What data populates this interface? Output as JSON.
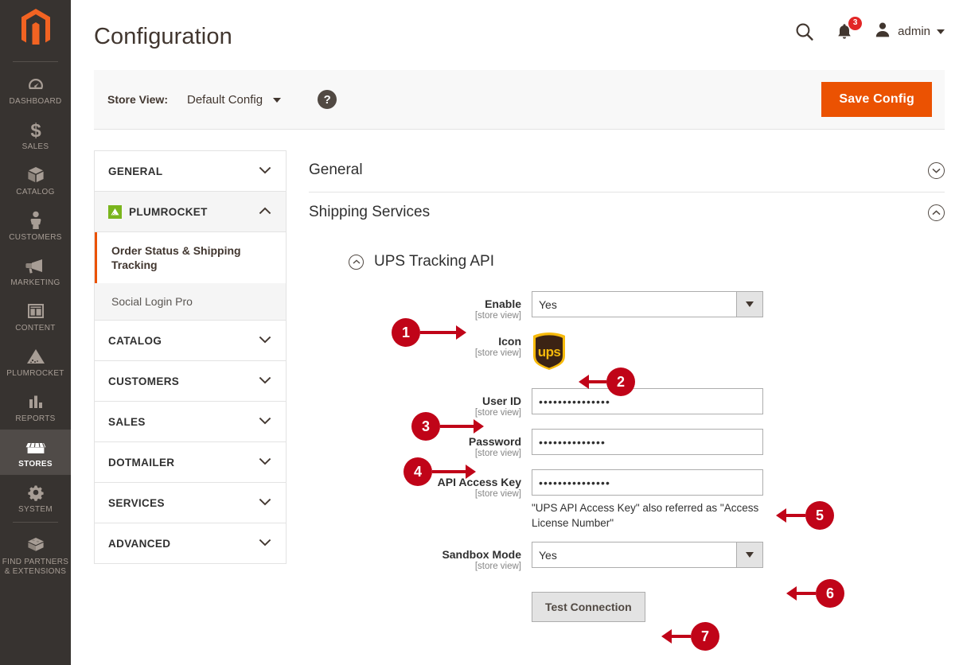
{
  "rail": {
    "logo_icon": "magento-logo-icon",
    "items": [
      {
        "label": "DASHBOARD",
        "icon": "dashboard-icon",
        "active": false
      },
      {
        "label": "SALES",
        "icon": "dollar-icon",
        "active": false
      },
      {
        "label": "CATALOG",
        "icon": "box-icon",
        "active": false
      },
      {
        "label": "CUSTOMERS",
        "icon": "person-icon",
        "active": false
      },
      {
        "label": "MARKETING",
        "icon": "megaphone-icon",
        "active": false
      },
      {
        "label": "CONTENT",
        "icon": "layout-icon",
        "active": false
      },
      {
        "label": "PLUMROCKET",
        "icon": "plumrocket-icon",
        "active": false
      },
      {
        "label": "REPORTS",
        "icon": "bar-chart-icon",
        "active": false
      },
      {
        "label": "STORES",
        "icon": "storefront-icon",
        "active": true
      },
      {
        "label": "SYSTEM",
        "icon": "gear-icon",
        "active": false
      },
      {
        "label": "FIND PARTNERS\n& EXTENSIONS",
        "icon": "puzzle-brick-icon",
        "active": false
      }
    ]
  },
  "header": {
    "title": "Configuration",
    "search_icon": "search-icon",
    "notifications_icon": "bell-icon",
    "notifications_count": "3",
    "avatar_icon": "user-avatar-icon",
    "user_name": "admin"
  },
  "storebar": {
    "label": "Store View:",
    "value": "Default Config",
    "help_icon": "question-mark-icon",
    "help_text": "?",
    "save_label": "Save Config"
  },
  "confignav": {
    "sections": [
      {
        "title": "GENERAL",
        "state": "collapsed",
        "icon": null
      },
      {
        "title": "PLUMROCKET",
        "state": "expanded",
        "icon": "plumrocket-logo-icon",
        "items": [
          {
            "label": "Order Status & Shipping Tracking",
            "current": true
          },
          {
            "label": "Social Login Pro",
            "current": false
          }
        ]
      },
      {
        "title": "CATALOG",
        "state": "collapsed",
        "icon": null
      },
      {
        "title": "CUSTOMERS",
        "state": "collapsed",
        "icon": null
      },
      {
        "title": "SALES",
        "state": "collapsed",
        "icon": null
      },
      {
        "title": "DOTMAILER",
        "state": "collapsed",
        "icon": null
      },
      {
        "title": "SERVICES",
        "state": "collapsed",
        "icon": null
      },
      {
        "title": "ADVANCED",
        "state": "collapsed",
        "icon": null
      }
    ]
  },
  "form": {
    "section_general": {
      "title": "General",
      "state": "collapsed"
    },
    "section_shipping": {
      "title": "Shipping Services",
      "state": "expanded"
    },
    "subsection_ups": {
      "title": "UPS Tracking API",
      "state": "expanded"
    },
    "scope_note": "[store view]",
    "fields": {
      "enable": {
        "label": "Enable",
        "scope": "[store view]",
        "value": "Yes"
      },
      "icon": {
        "label": "Icon",
        "scope": "[store view]",
        "image": "ups-shield-logo"
      },
      "user_id": {
        "label": "User ID",
        "scope": "[store view]",
        "value": "•••••••••••••••"
      },
      "password": {
        "label": "Password",
        "scope": "[store view]",
        "value": "••••••••••••••"
      },
      "api_key": {
        "label": "API Access Key",
        "scope": "[store view]",
        "value": "•••••••••••••••",
        "note": "\"UPS API Access Key\" also referred as \"Access License Number\""
      },
      "sandbox": {
        "label": "Sandbox Mode",
        "scope": "[store view]",
        "value": "Yes"
      }
    },
    "test_connection_label": "Test Connection"
  },
  "annotations": {
    "color": "#c00418",
    "markers": [
      {
        "number": "1",
        "target": "enable-field",
        "direction": "right"
      },
      {
        "number": "2",
        "target": "icon-field",
        "direction": "left"
      },
      {
        "number": "3",
        "target": "user-id-field",
        "direction": "right"
      },
      {
        "number": "4",
        "target": "password-field",
        "direction": "right"
      },
      {
        "number": "5",
        "target": "api-access-key-field",
        "direction": "left"
      },
      {
        "number": "6",
        "target": "sandbox-mode-field",
        "direction": "left"
      },
      {
        "number": "7",
        "target": "test-connection-button",
        "direction": "left"
      }
    ]
  }
}
